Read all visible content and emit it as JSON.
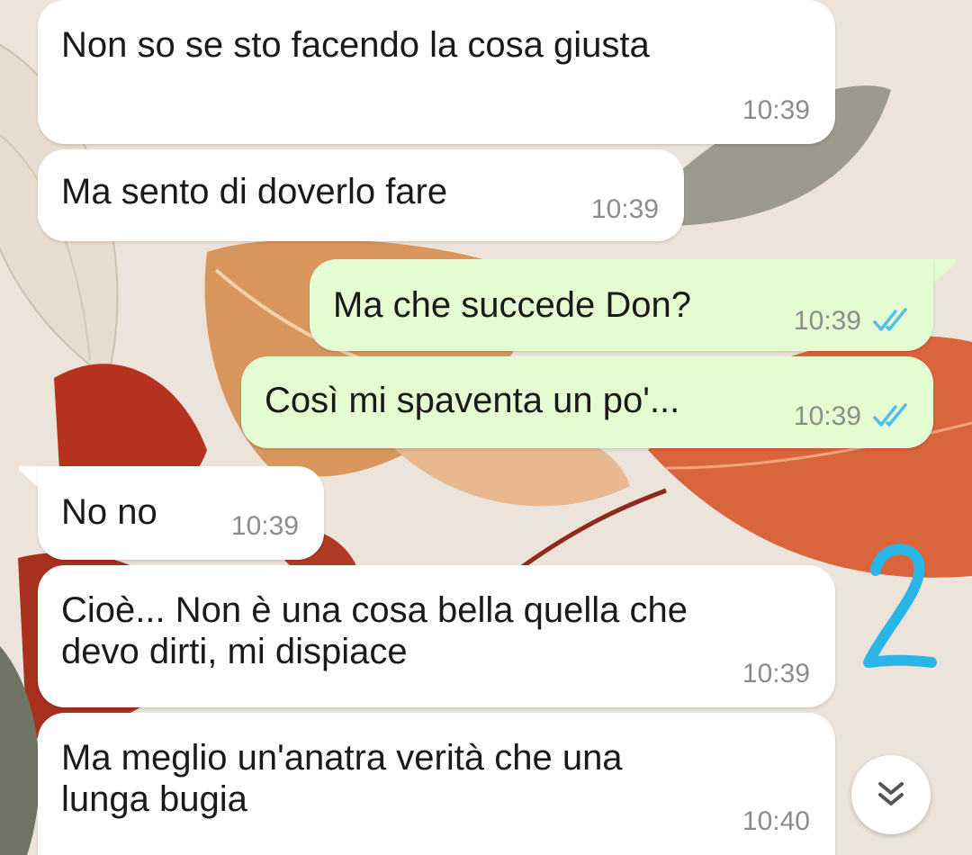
{
  "chat": {
    "messages": [
      {
        "direction": "incoming",
        "text": "Non so se sto facendo la cosa giusta",
        "time": "10:39"
      },
      {
        "direction": "incoming",
        "text": "Ma sento di doverlo fare",
        "time": "10:39"
      },
      {
        "direction": "outgoing",
        "text": "Ma che succede Don?",
        "time": "10:39",
        "status": "read-double-check-icon"
      },
      {
        "direction": "outgoing",
        "text": "Così mi spaventa un po'...",
        "time": "10:39",
        "status": "read-double-check-icon"
      },
      {
        "direction": "incoming",
        "text": "No no",
        "time": "10:39"
      },
      {
        "direction": "incoming",
        "text": "Cioè... Non è una cosa bella quella che\ndevo dirti, mi dispiace",
        "time": "10:39"
      },
      {
        "direction": "incoming",
        "text": "Ma meglio un'anatra verità che una\nlunga bugia",
        "time": "10:40"
      }
    ]
  },
  "annotation": {
    "text": "2",
    "color": "#29b6e6"
  },
  "scroll_button": {
    "icon": "double-chevron-down-icon"
  },
  "colors": {
    "incoming_bubble": "#ffffff",
    "outgoing_bubble": "#e4fcd2",
    "read_ticks": "#53bdeb",
    "timestamp": "#8c8c8c"
  },
  "wallpaper": {
    "icon": "autumn-leaves-wallpaper"
  }
}
